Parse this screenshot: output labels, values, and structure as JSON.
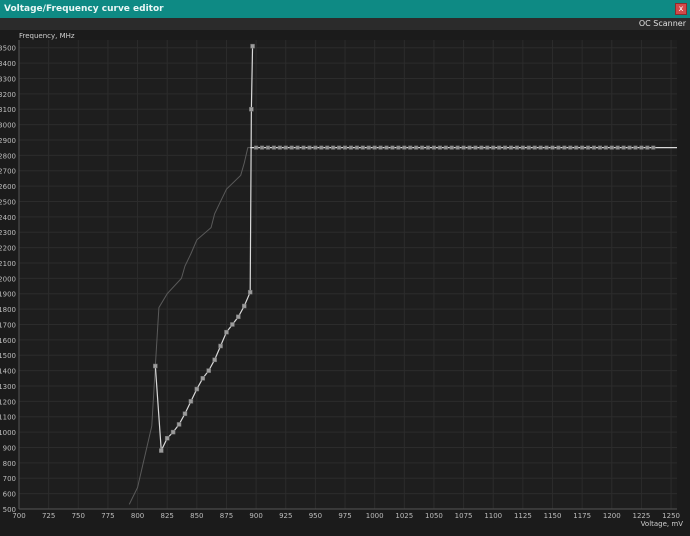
{
  "window": {
    "title": "Voltage/Frequency curve editor",
    "close_glyph": "x"
  },
  "toolbar": {
    "oc_scanner_label": "OC Scanner"
  },
  "colors": {
    "titlebar": "#0e8a84",
    "background": "#1b1b1b",
    "curve": "#d9d9d9",
    "close": "#d24a4a"
  },
  "chart_data": {
    "type": "line",
    "ylabel": "Frequency, MHz",
    "xlabel": "Voltage, mV",
    "xlim": [
      700,
      1255
    ],
    "ylim": [
      500,
      3550
    ],
    "x_ticks": [
      700,
      725,
      750,
      775,
      800,
      825,
      850,
      875,
      900,
      925,
      950,
      975,
      1000,
      1025,
      1050,
      1075,
      1100,
      1125,
      1150,
      1175,
      1200,
      1225,
      1250
    ],
    "y_ticks": [
      500,
      600,
      700,
      800,
      900,
      1000,
      1100,
      1200,
      1300,
      1400,
      1500,
      1600,
      1700,
      1800,
      1900,
      2000,
      2100,
      2200,
      2300,
      2400,
      2500,
      2600,
      2700,
      2800,
      2900,
      3000,
      3100,
      3200,
      3300,
      3400,
      3500
    ],
    "grid": true,
    "series": [
      {
        "x": [
          793,
          800,
          812,
          815,
          818,
          825,
          837,
          840,
          845,
          850,
          862,
          865,
          870,
          875,
          887,
          890,
          893,
          895,
          900
        ],
        "y": [
          530,
          640,
          1040,
          1430,
          1810,
          1900,
          2000,
          2080,
          2160,
          2250,
          2330,
          2420,
          2500,
          2580,
          2670,
          2750,
          2850,
          2850,
          2850
        ]
      },
      {
        "x": [
          895,
          1255
        ],
        "y": [
          2850,
          2850
        ]
      },
      {
        "x": [
          815,
          820,
          825,
          830,
          835,
          840,
          845,
          850,
          855,
          860,
          865,
          870,
          875,
          880,
          885,
          890,
          895,
          896,
          897
        ],
        "y": [
          1430,
          880,
          960,
          1000,
          1050,
          1120,
          1200,
          1280,
          1350,
          1400,
          1470,
          1560,
          1650,
          1700,
          1750,
          1820,
          1910,
          3100,
          3510
        ]
      }
    ]
  }
}
